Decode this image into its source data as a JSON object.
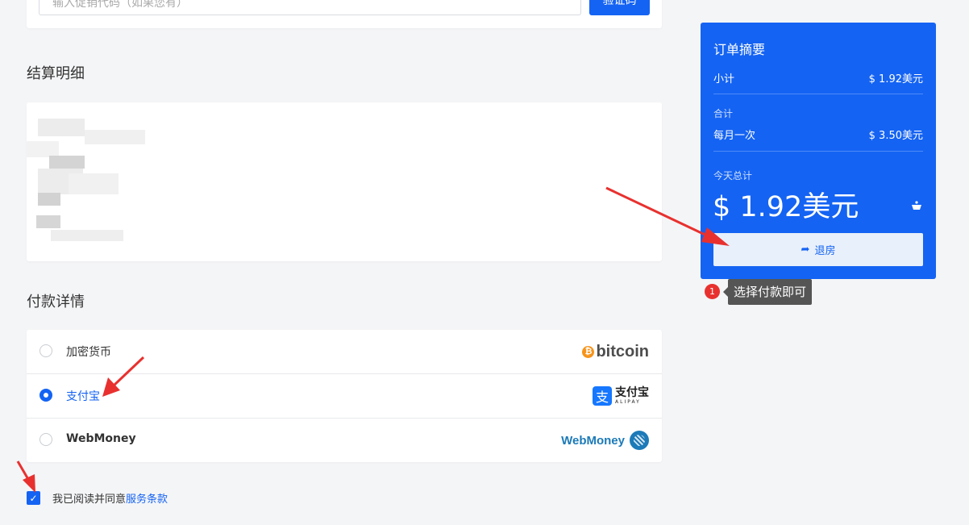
{
  "promo": {
    "placeholder": "输入促销代码（如果您有）",
    "button": "验证码"
  },
  "billing": {
    "title": "结算明细"
  },
  "payment": {
    "title": "付款详情",
    "methods": [
      {
        "label": "加密货币",
        "logo": "bitcoin",
        "logo_text": "bitcoin",
        "selected": false
      },
      {
        "label": "支付宝",
        "logo": "alipay",
        "logo_text": "支付宝",
        "logo_sub": "ALIPAY",
        "selected": true
      },
      {
        "label": "WebMoney",
        "logo": "webmoney",
        "logo_text": "WebMoney",
        "selected": false
      }
    ]
  },
  "terms": {
    "text": "我已阅读并同意",
    "link": "服务条款",
    "checked": true
  },
  "summary": {
    "title": "订单摘要",
    "subtotal_label": "小计",
    "subtotal_value": "$ 1.92美元",
    "total_label": "合计",
    "cycle_label": "每月一次",
    "cycle_value": "$ 3.50美元",
    "today_label": "今天总计",
    "today_value": "$ 1.92美元",
    "checkout_label": "退房"
  },
  "tooltip": {
    "badge": "1",
    "text": "选择付款即可"
  },
  "colors": {
    "accent": "#1463f3",
    "annotation": "#e8312f"
  }
}
